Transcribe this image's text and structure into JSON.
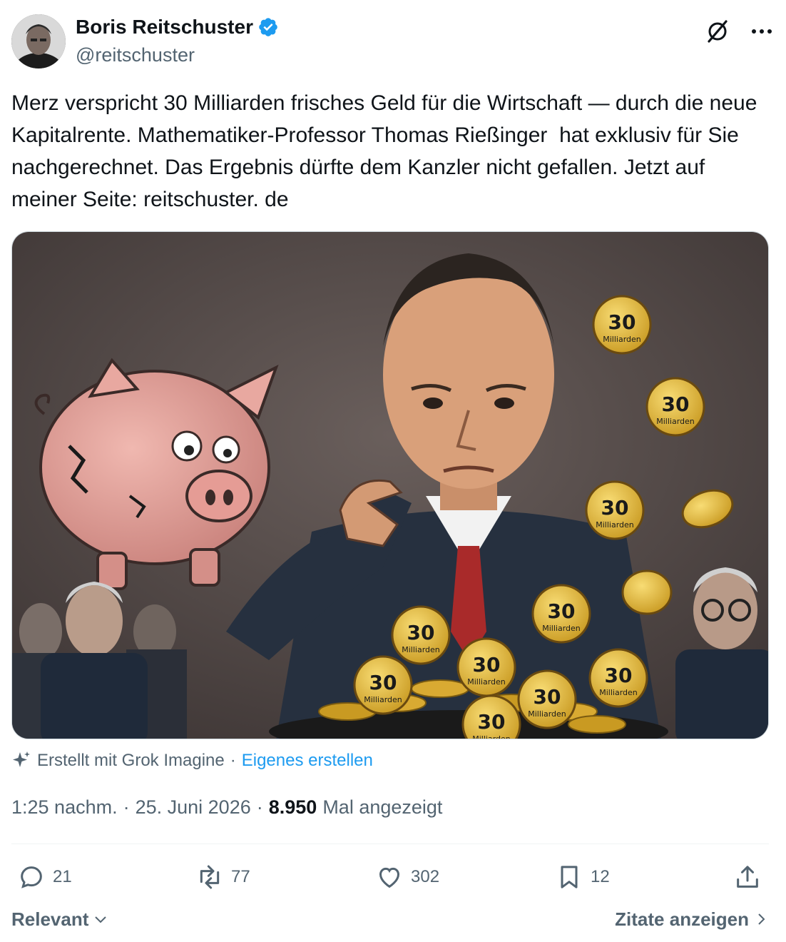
{
  "author": {
    "display_name": "Boris Reitschuster",
    "handle": "@reitschuster",
    "verified": true
  },
  "icons": {
    "verified": "verified-badge-icon",
    "grok": "grok-icon",
    "more": "more-icon",
    "sparkle": "sparkle-icon",
    "reply": "reply-icon",
    "retweet": "retweet-icon",
    "like": "like-icon",
    "bookmark": "bookmark-icon",
    "share": "share-icon"
  },
  "tweet": {
    "text": "Merz verspricht 30 Milliarden frisches Geld für die Wirtschaft — durch die neue Kapitalrente. Mathematiker-Professor Thomas Rießinger  hat exklusiv für Sie nachgerechnet. Das Ergebnis dürfte dem Kanzler nicht gefallen. Jetzt auf meiner Seite: reitschuster. de"
  },
  "media": {
    "coin_number": "30",
    "coin_label": "Milliarden"
  },
  "grok_attribution": {
    "text": "Erstellt mit Grok Imagine",
    "separator": "·",
    "link": "Eigenes erstellen"
  },
  "meta": {
    "time": "1:25 nachm.",
    "sep1": "·",
    "date": "25. Juni 2026",
    "sep2": "·",
    "views": "8.950",
    "views_label": "Mal angezeigt"
  },
  "actions": {
    "replies": "21",
    "retweets": "77",
    "likes": "302",
    "bookmarks": "12"
  },
  "footer": {
    "sort_label": "Relevant",
    "quotes_label": "Zitate anzeigen"
  },
  "colors": {
    "accent": "#1d9bf0",
    "text_primary": "#0f1419",
    "text_secondary": "#536471",
    "coin_gold": "#e4b83a"
  }
}
